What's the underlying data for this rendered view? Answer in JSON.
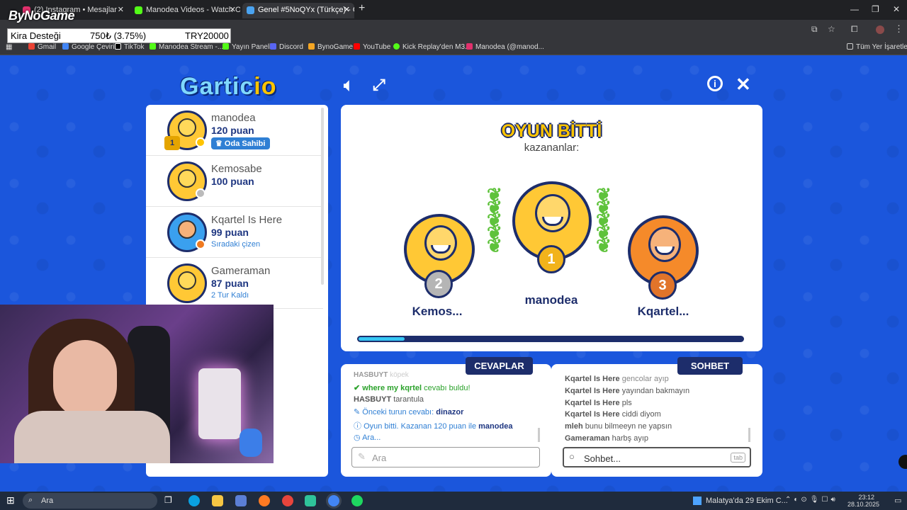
{
  "browser": {
    "tabs": [
      {
        "label": "(2) Instagram • Mesajlar",
        "active": false
      },
      {
        "label": "Manodea Videos - Watch On-D",
        "active": false
      },
      {
        "label": "Genel #5NoQYx (Türkçe) - Garti",
        "active": true
      }
    ],
    "bookmarks": [
      "Gmail",
      "Google Çeviri",
      "TikTok",
      "Manodea Stream -...",
      "Yayın Paneli",
      "Discord",
      "BynoGame",
      "YouTube",
      "Kick Replay'den M3...",
      "Manodea (@manod...",
      "Tüm Yer İşaretleri"
    ]
  },
  "overlay": {
    "brand": "ByNoGame",
    "donation_label": "Kira Desteği",
    "donation_progress": "750₺ (3.75%)",
    "donation_goal": "TRY20000"
  },
  "game": {
    "logo": "Gartic",
    "logo_suffix": "io",
    "players": [
      {
        "name": "manodea",
        "points": "120 puan",
        "tag": "Oda Sahibi",
        "rank": "1"
      },
      {
        "name": "Kemosabe",
        "points": "100 puan",
        "tag": ""
      },
      {
        "name": "Kqartel Is Here",
        "points": "99 puan",
        "tag": "Sıradaki çizen"
      },
      {
        "name": "Gameraman",
        "points": "87 puan",
        "tag": "2 Tur Kaldı"
      }
    ],
    "result": {
      "title": "OYUN BİTTİ",
      "subtitle": "kazananlar:",
      "winners": [
        {
          "place": "2",
          "name": "Kemos..."
        },
        {
          "place": "1",
          "name": "manodea"
        },
        {
          "place": "3",
          "name": "Kqartel..."
        }
      ],
      "progress_fraction": 0.12
    },
    "answers": {
      "tab": "CEVAPLAR",
      "messages": [
        {
          "user": "HASBUYT",
          "text": "köpek"
        },
        {
          "user": "where my kqrtel",
          "text": "cevabı buldu!"
        },
        {
          "user": "HASBUYT",
          "text": "tarantula"
        },
        {
          "user": "Önceki turun cevabı:",
          "text": "dinazor"
        },
        {
          "user": "Oyun bitti. Kazanan 120 puan ile",
          "text": "manodea"
        },
        {
          "user": "Ara...",
          "text": ""
        }
      ],
      "input_placeholder": "Ara"
    },
    "chat": {
      "tab": "SOHBET",
      "messages": [
        {
          "user": "Kqartel Is Here",
          "text": "gencolar ayıp"
        },
        {
          "user": "Kqartel Is Here",
          "text": "yayından bakmayın"
        },
        {
          "user": "Kqartel Is Here",
          "text": "pls"
        },
        {
          "user": "Kqartel Is Here",
          "text": "ciddi diyom"
        },
        {
          "user": "mleh",
          "text": "bunu bilmeeyn ne yapsın"
        },
        {
          "user": "Gameraman",
          "text": "harbş ayıp"
        }
      ],
      "input_placeholder": "Sohbet...",
      "tab_key": "tab"
    }
  },
  "taskbar": {
    "search_placeholder": "Ara",
    "weather": "Malatya'da 29 Ekim C...",
    "time": "23:12",
    "date": "28.10.2025"
  },
  "colors": {
    "bg": "#1b56dc",
    "navy": "#1d2d6b",
    "gold": "#ffc400"
  }
}
